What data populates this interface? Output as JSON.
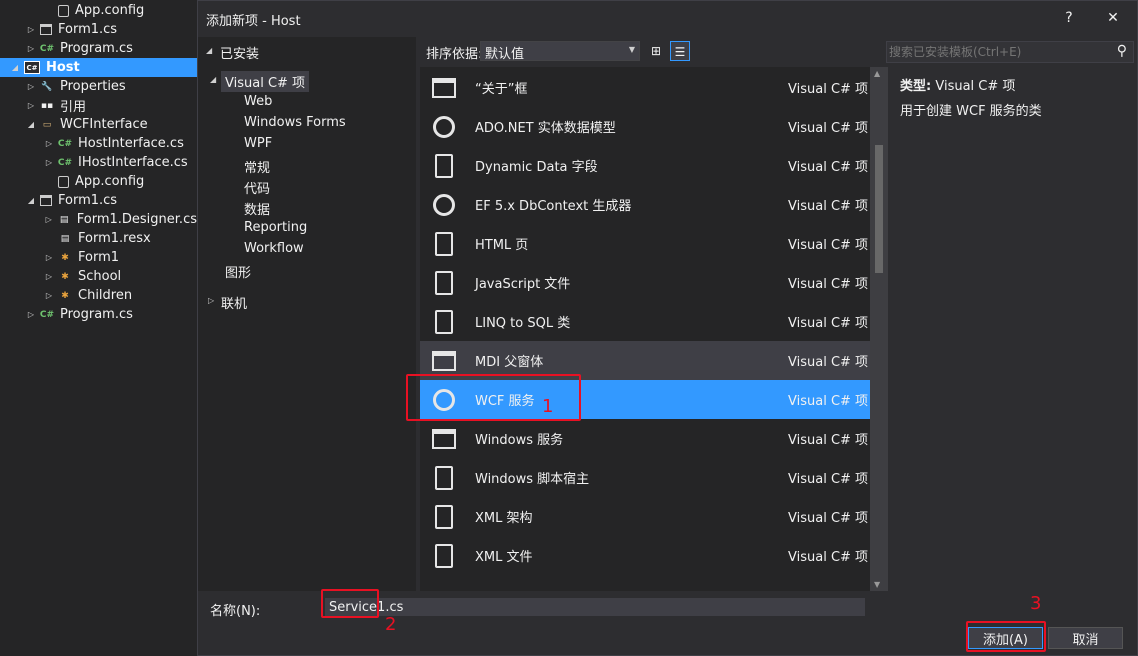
{
  "solution": {
    "rows": [
      {
        "label": "App.config",
        "icon": "config-icon",
        "arrow": ""
      },
      {
        "label": "Form1.cs",
        "icon": "form-icon",
        "arrow": "▷"
      },
      {
        "label": "Program.cs",
        "icon": "csharp-icon",
        "arrow": "▷"
      },
      {
        "label": "Host",
        "icon": "project-icon",
        "arrow": "◢"
      },
      {
        "label": "Properties",
        "icon": "wrench-icon",
        "arrow": "▷"
      },
      {
        "label": "引用",
        "icon": "references-icon",
        "arrow": "▷"
      },
      {
        "label": "WCFInterface",
        "icon": "folder-icon",
        "arrow": "◢"
      },
      {
        "label": "HostInterface.cs",
        "icon": "csharp-icon",
        "arrow": "▷"
      },
      {
        "label": "IHostInterface.cs",
        "icon": "csharp-icon",
        "arrow": "▷"
      },
      {
        "label": "App.config",
        "icon": "config-icon",
        "arrow": ""
      },
      {
        "label": "Form1.cs",
        "icon": "form-icon",
        "arrow": "◢"
      },
      {
        "label": "Form1.Designer.cs",
        "icon": "designer-icon",
        "arrow": "▷"
      },
      {
        "label": "Form1.resx",
        "icon": "resx-icon",
        "arrow": ""
      },
      {
        "label": "Form1",
        "icon": "class-icon",
        "arrow": "▷"
      },
      {
        "label": "School",
        "icon": "class-icon",
        "arrow": "▷"
      },
      {
        "label": "Children",
        "icon": "class-icon",
        "arrow": "▷"
      },
      {
        "label": "Program.cs",
        "icon": "csharp-icon",
        "arrow": "▷"
      }
    ]
  },
  "dialog": {
    "title": "添加新项 - Host",
    "help_glyph": "?",
    "close_glyph": "✕",
    "installed": "已安装",
    "categories": {
      "root": "Visual C# 项",
      "children": [
        "Web",
        "Windows Forms",
        "WPF",
        "常规",
        "代码",
        "数据",
        "Reporting",
        "Workflow"
      ],
      "graphics": "图形",
      "online": "联机"
    },
    "sort_label": "排序依据:",
    "sort_value": "默认值",
    "search_placeholder": "搜索已安装模板(Ctrl+E)",
    "templates": [
      {
        "name": "“关于”框",
        "lang": "Visual C# 项",
        "icon": "about-box-icon"
      },
      {
        "name": "ADO.NET 实体数据模型",
        "lang": "Visual C# 项",
        "icon": "entity-model-icon"
      },
      {
        "name": "Dynamic Data 字段",
        "lang": "Visual C# 项",
        "icon": "dynamic-data-icon"
      },
      {
        "name": "EF 5.x DbContext 生成器",
        "lang": "Visual C# 项",
        "icon": "ef-generator-icon"
      },
      {
        "name": "HTML 页",
        "lang": "Visual C# 项",
        "icon": "html-page-icon"
      },
      {
        "name": "JavaScript 文件",
        "lang": "Visual C# 项",
        "icon": "javascript-file-icon"
      },
      {
        "name": "LINQ to SQL 类",
        "lang": "Visual C# 项",
        "icon": "linq-sql-icon"
      },
      {
        "name": "MDI 父窗体",
        "lang": "Visual C# 项",
        "icon": "mdi-form-icon"
      },
      {
        "name": "WCF 服务",
        "lang": "Visual C# 项",
        "icon": "wcf-service-icon"
      },
      {
        "name": "Windows 服务",
        "lang": "Visual C# 项",
        "icon": "windows-service-icon"
      },
      {
        "name": "Windows 脚本宿主",
        "lang": "Visual C# 项",
        "icon": "script-host-icon"
      },
      {
        "name": "XML 架构",
        "lang": "Visual C# 项",
        "icon": "xml-schema-icon"
      },
      {
        "name": "XML 文件",
        "lang": "Visual C# 项",
        "icon": "xml-file-icon"
      }
    ],
    "detail": {
      "type_label": "类型:",
      "type_value": "Visual C# 项",
      "description": "用于创建 WCF 服务的类"
    },
    "name_label": "名称(N):",
    "name_value": "Service1.cs",
    "add_button": "添加(A)",
    "cancel_button": "取消"
  },
  "annotations": [
    "1",
    "2",
    "3"
  ],
  "colors": {
    "accent": "#3399ff",
    "annotation": "#e81123",
    "background": "#2d2d30"
  }
}
